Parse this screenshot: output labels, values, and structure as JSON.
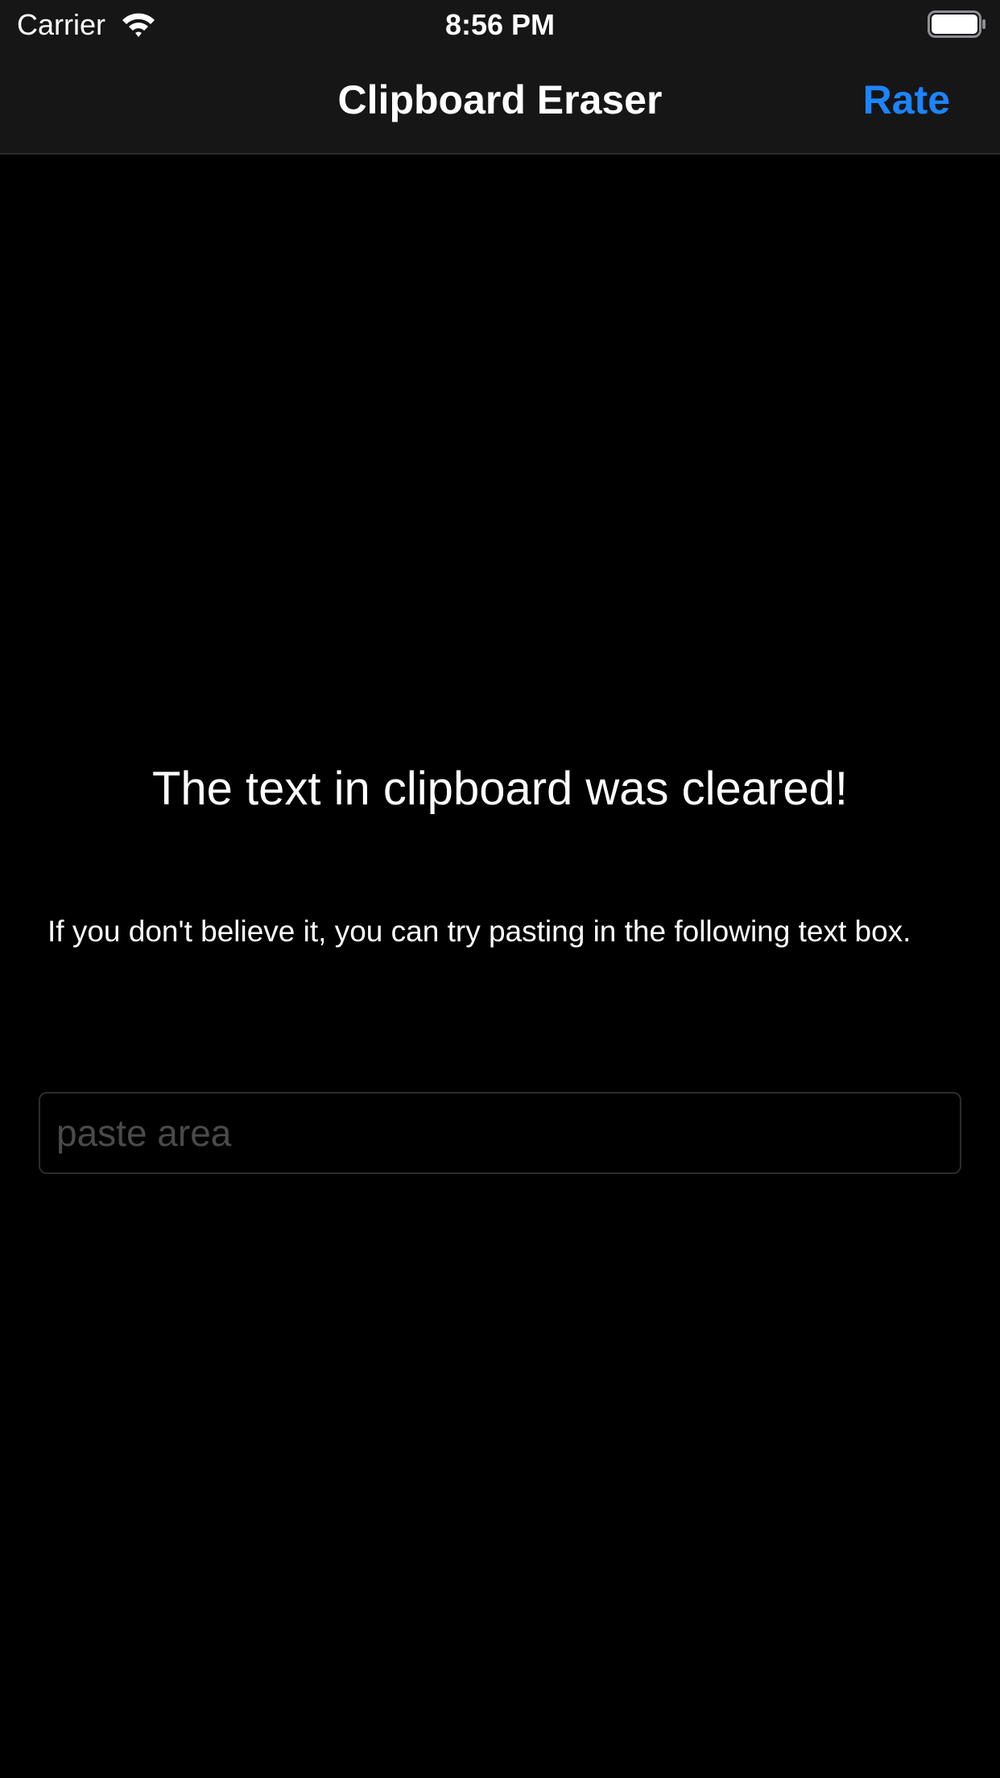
{
  "status_bar": {
    "carrier": "Carrier",
    "time": "8:56 PM",
    "wifi_icon": "wifi-icon",
    "battery_icon": "battery-icon"
  },
  "nav": {
    "title": "Clipboard Eraser",
    "rate_label": "Rate"
  },
  "main": {
    "message": "The text in clipboard was cleared!",
    "hint": "If you don't believe it, you can try pasting in the following text box.",
    "paste_field": {
      "value": "",
      "placeholder": "paste area"
    }
  },
  "colors": {
    "background": "#000000",
    "bar_background": "#161616",
    "accent": "#1d84ff",
    "text": "#ffffff",
    "placeholder": "#4a4a4c"
  }
}
